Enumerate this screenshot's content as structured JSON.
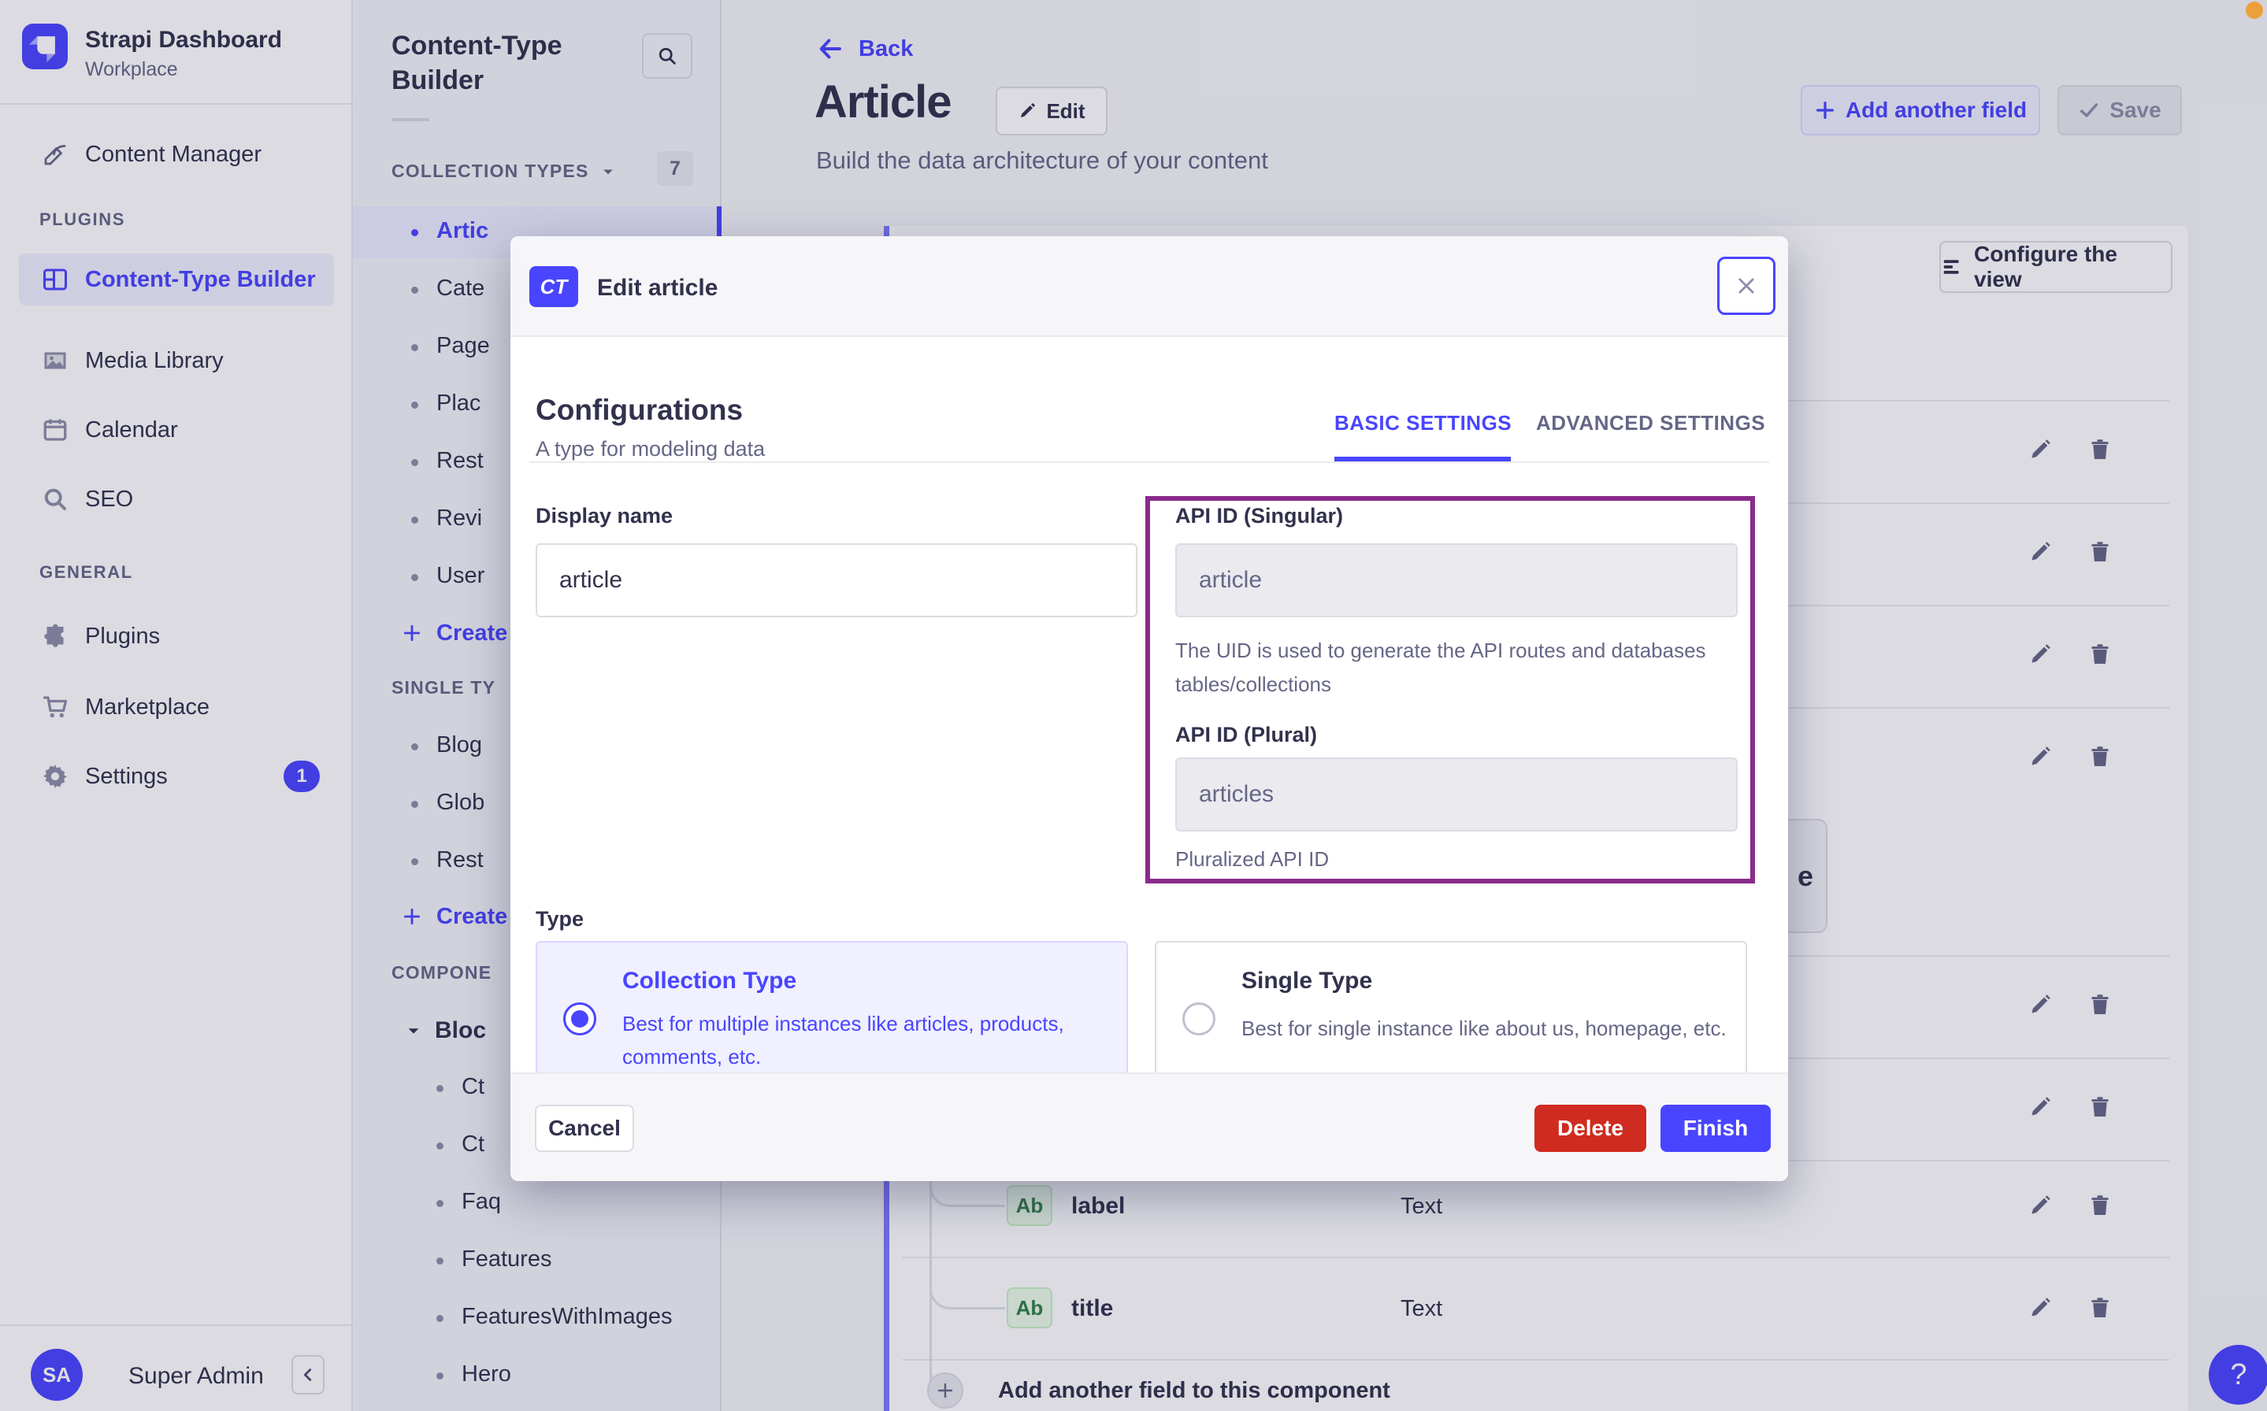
{
  "brand": {
    "title": "Strapi Dashboard",
    "subtitle": "Workplace"
  },
  "nav": {
    "content_manager": "Content Manager",
    "plugins_section": "PLUGINS",
    "general_section": "GENERAL",
    "items": {
      "ctb": "Content-Type Builder",
      "media": "Media Library",
      "calendar": "Calendar",
      "seo": "SEO",
      "plugins": "Plugins",
      "marketplace": "Marketplace",
      "settings": "Settings"
    },
    "settings_badge": "1",
    "user": {
      "initials": "SA",
      "name": "Super Admin"
    }
  },
  "subnav": {
    "title": "Content-Type Builder",
    "collection": {
      "label": "COLLECTION TYPES",
      "count": "7",
      "items": [
        "Artic",
        "Cate",
        "Page",
        "Plac",
        "Rest",
        "Revi",
        "User"
      ],
      "active_index": 0,
      "create": "Create"
    },
    "single": {
      "label": "SINGLE TY",
      "items": [
        "Blog",
        "Glob",
        "Rest"
      ],
      "create": "Create"
    },
    "components": {
      "label": "COMPONE",
      "group": "Bloc",
      "items": [
        "Ct",
        "Ct",
        "Faq",
        "Features",
        "FeaturesWithImages",
        "Hero"
      ]
    }
  },
  "header": {
    "back": "Back",
    "title": "Article",
    "edit": "Edit",
    "subtitle": "Build the data architecture of your content",
    "add_field": "Add another field",
    "save": "Save"
  },
  "content": {
    "configure": "Configure the view",
    "fields": [
      {
        "chip": "Ab",
        "name": "label",
        "type": "Text"
      },
      {
        "chip": "Ab",
        "name": "title",
        "type": "Text"
      }
    ],
    "add_component_field": "Add another field to this component",
    "partial_text": "e",
    "help": "?"
  },
  "modal": {
    "badge": "CT",
    "title": "Edit article",
    "heading": "Configurations",
    "subheading": "A type for modeling data",
    "tab_basic": "BASIC SETTINGS",
    "tab_advanced": "ADVANCED SETTINGS",
    "display_name": {
      "label": "Display name",
      "value": "article"
    },
    "api_singular": {
      "label": "API ID (Singular)",
      "value": "article",
      "help_line1": "The UID is used to generate the API routes and databases",
      "help_line2": "tables/collections"
    },
    "api_plural": {
      "label": "API ID (Plural)",
      "value": "articles",
      "help": "Pluralized API ID"
    },
    "type_label": "Type",
    "collection_card": {
      "title": "Collection Type",
      "desc_line1": "Best for multiple instances like articles, products,",
      "desc_line2": "comments, etc."
    },
    "single_card": {
      "title": "Single Type",
      "desc": "Best for single instance like about us, homepage, etc."
    },
    "cancel": "Cancel",
    "delete": "Delete",
    "finish": "Finish"
  },
  "colors": {
    "accent": "#4945FF",
    "danger": "#D02B20",
    "annotation": "#8A2B8A",
    "recording_dot": "#ECA03C",
    "chip_green_bg": "#EAFBE7",
    "chip_green_text": "#328048"
  }
}
